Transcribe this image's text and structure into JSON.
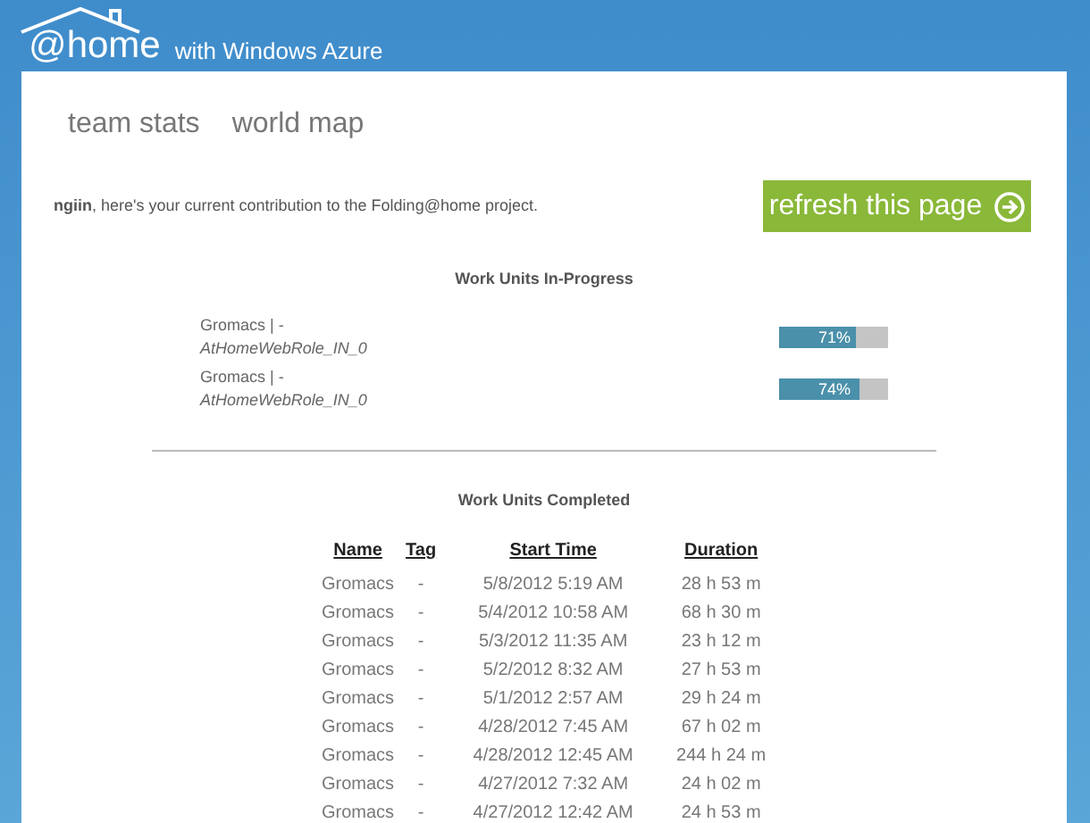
{
  "header": {
    "logo": "@home",
    "subtitle": "with Windows Azure"
  },
  "nav": [
    {
      "label": "team stats"
    },
    {
      "label": "world map"
    }
  ],
  "intro": "**ngiin**, here's your current contribution to the Folding@home project.",
  "refresh_button": {
    "label": "refresh this page"
  },
  "in_progress": {
    "title": "Work Units In-Progress",
    "items": [
      {
        "name": "Gromacs | -",
        "role": "AtHomeWebRole_IN_0",
        "level": 0.71,
        "reading": "71%"
      },
      {
        "name": "Gromacs | -",
        "role": "AtHomeWebRole_IN_0",
        "level": 0.74,
        "reading": "74%"
      }
    ]
  },
  "completed": {
    "title": "Work Units Completed",
    "columns": [
      "Name",
      "Tag",
      "Start Time",
      "Duration"
    ],
    "rows": [
      [
        "Gromacs",
        "-",
        "5/8/2012 5:19 AM",
        "28 h 53 m"
      ],
      [
        "Gromacs",
        "-",
        "5/4/2012 10:58 AM",
        "68 h 30 m"
      ],
      [
        "Gromacs",
        "-",
        "5/3/2012 11:35 AM",
        "23 h 12 m"
      ],
      [
        "Gromacs",
        "-",
        "5/2/2012 8:32 AM",
        "27 h 53 m"
      ],
      [
        "Gromacs",
        "-",
        "5/1/2012 2:57 AM",
        "29 h 24 m"
      ],
      [
        "Gromacs",
        "-",
        "4/28/2012 7:45 AM",
        "67 h 02 m"
      ],
      [
        "Gromacs",
        "-",
        "4/28/2012 12:45 AM",
        "244 h 24 m"
      ],
      [
        "Gromacs",
        "-",
        "4/27/2012 7:32 AM",
        "24 h 02 m"
      ],
      [
        "Gromacs",
        "-",
        "4/27/2012 12:42 AM",
        "24 h 53 m"
      ]
    ]
  }
}
